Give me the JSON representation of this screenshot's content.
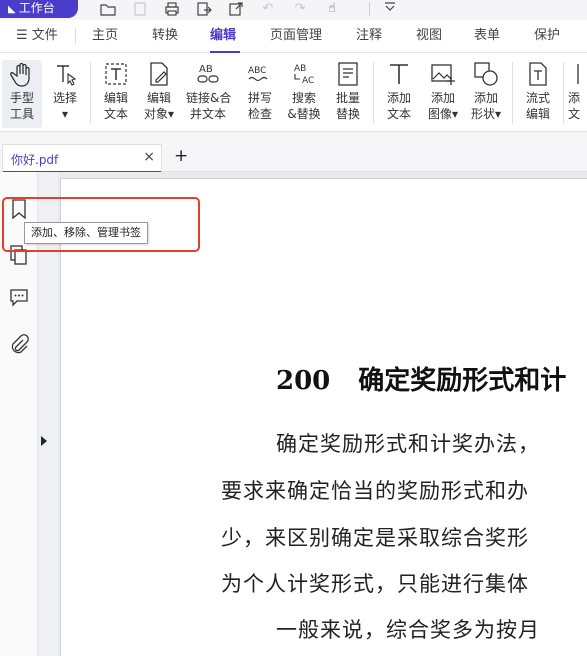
{
  "toolbar": {
    "workspace_label": "工作台"
  },
  "menu": {
    "file_label": "文件",
    "items": [
      "主页",
      "转换",
      "编辑",
      "页面管理",
      "注释",
      "视图",
      "表单",
      "保护"
    ],
    "active": "编辑"
  },
  "ribbon": {
    "tools": [
      {
        "l1": "手型",
        "l2": "工具",
        "icon": "hand-icon"
      },
      {
        "l1": "选择",
        "l2": "▾",
        "icon": "select-cursor-icon"
      },
      {
        "l1": "编辑",
        "l2": "文本",
        "icon": "edit-text-icon"
      },
      {
        "l1": "编辑",
        "l2": "对象▾",
        "icon": "edit-object-icon"
      },
      {
        "l1": "链接&合",
        "l2": "并文本",
        "icon": "link-merge-text-icon"
      },
      {
        "l1": "拼写",
        "l2": "检查",
        "icon": "spell-check-icon"
      },
      {
        "l1": "搜索",
        "l2": "&替换",
        "icon": "search-replace-icon"
      },
      {
        "l1": "批量",
        "l2": "替换",
        "icon": "batch-replace-icon"
      },
      {
        "l1": "添加",
        "l2": "文本",
        "icon": "add-text-icon"
      },
      {
        "l1": "添加",
        "l2": "图像▾",
        "icon": "add-image-icon"
      },
      {
        "l1": "添加",
        "l2": "形状▾",
        "icon": "add-shape-icon"
      },
      {
        "l1": "流式",
        "l2": "编辑",
        "icon": "flow-edit-icon"
      },
      {
        "l1": "添",
        "l2": "文",
        "icon": "add-more-icon"
      }
    ]
  },
  "tabs": {
    "file_name": "你好.pdf",
    "close_symbol": "×",
    "add_symbol": "+"
  },
  "tooltip": {
    "text": "添加、移除、管理书签"
  },
  "document": {
    "heading_number": "200",
    "heading_title": "确定奖励形式和计",
    "lines": [
      "确定奖励形式和计奖办法，",
      "要求来确定恰当的奖励形式和办",
      "少，来区别确定是采取综合奖形",
      "为个人计奖形式，只能进行集体",
      "一般来说，综合奖多为按月"
    ]
  },
  "colors": {
    "accent": "#4b3cc9",
    "highlight": "#e0402d"
  }
}
